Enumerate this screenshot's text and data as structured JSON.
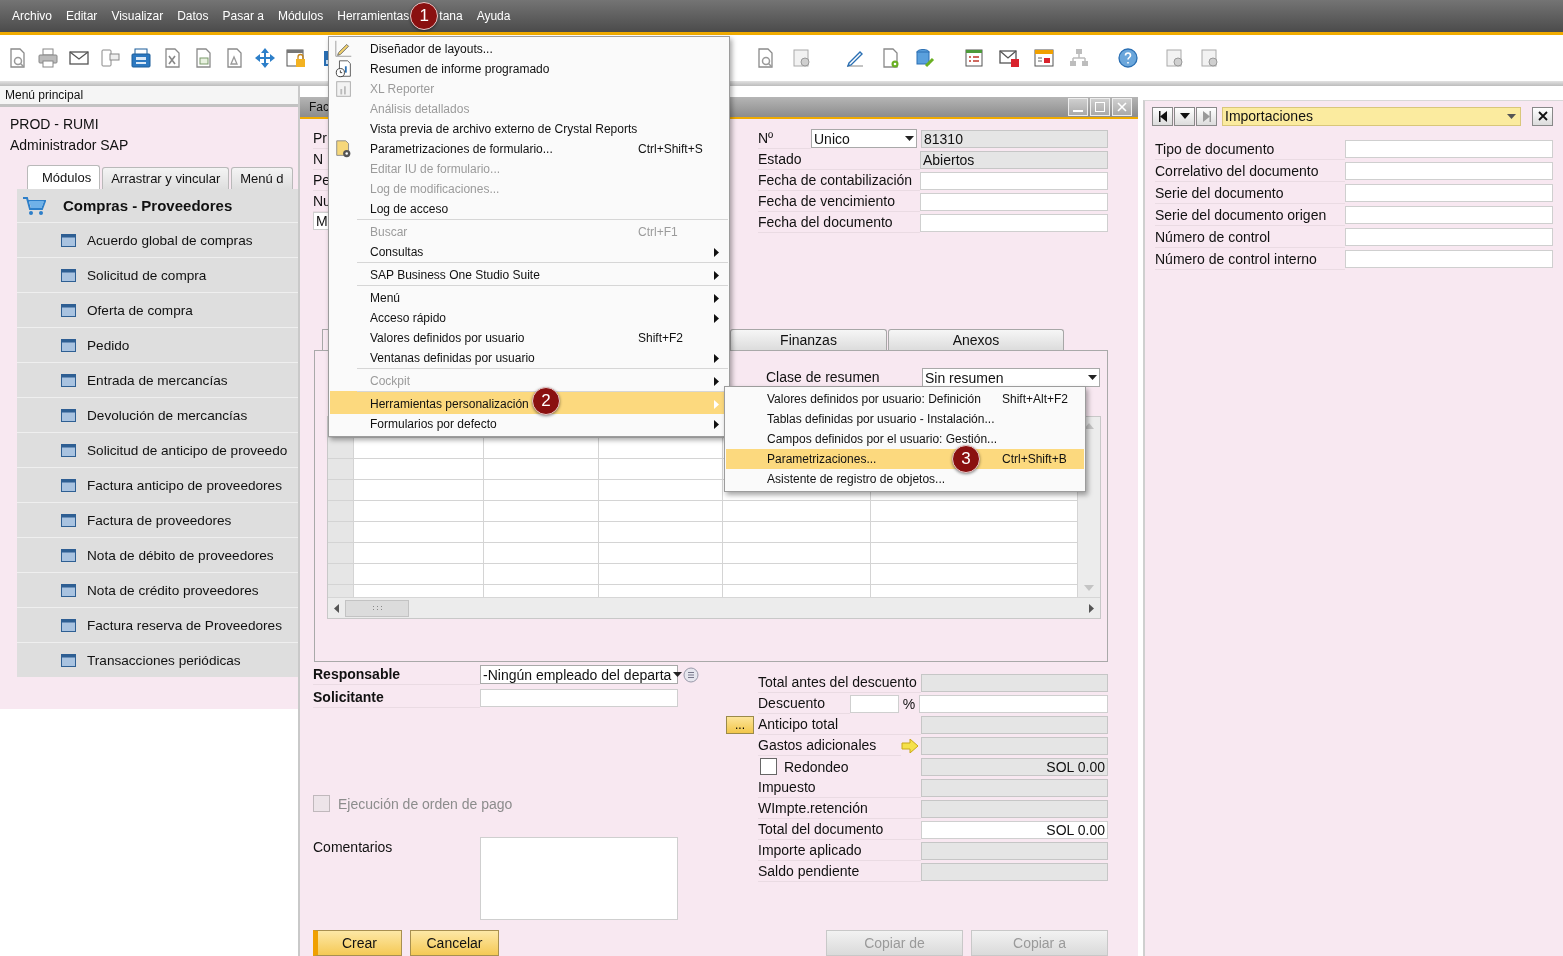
{
  "menu_bar": [
    {
      "label": "Archivo"
    },
    {
      "label": "Editar"
    },
    {
      "label": "Visualizar"
    },
    {
      "label": "Datos"
    },
    {
      "label": "Pasar a"
    },
    {
      "label": "Módulos"
    },
    {
      "label": "Herramientas",
      "callout": "1"
    },
    {
      "label": "tana"
    },
    {
      "label": "Ayuda"
    }
  ],
  "main_menu": {
    "title": "Menú principal",
    "company": "PROD - RUMI",
    "user": "Administrador SAP",
    "tabs": [
      {
        "label": "Módulos",
        "selected": true
      },
      {
        "label": "Arrastrar y vincular",
        "selected": false
      },
      {
        "label": "Menú d",
        "selected": false
      }
    ],
    "module": "Compras - Proveedores",
    "items": [
      "Acuerdo global de compras",
      "Solicitud de compra",
      "Oferta de compra",
      "Pedido",
      "Entrada de mercancías",
      "Devolución de mercancías",
      "Solicitud de anticipo de proveedo",
      "Factura anticipo de proveedores",
      "Factura de proveedores",
      "Nota de débito de proveedores",
      "Nota de crédito proveedores",
      "Factura reserva de Proveedores",
      "Transacciones periódicas"
    ]
  },
  "form_window": {
    "title": "Fac",
    "header_left": [
      "Pr",
      "N",
      "Pe",
      "Nu"
    ],
    "header_left_field": "M",
    "header_right": [
      {
        "label": "Nº",
        "kind": "series",
        "series": "Unico",
        "value": "81310"
      },
      {
        "label": "Estado",
        "kind": "readonly",
        "value": "Abiertos"
      },
      {
        "label": "Fecha de contabilización",
        "kind": "input"
      },
      {
        "label": "Fecha de vencimiento",
        "kind": "input"
      },
      {
        "label": "Fecha del documento",
        "kind": "input"
      }
    ],
    "tabs": [
      {
        "label": "Finanzas",
        "selected": false
      },
      {
        "label": "Anexos",
        "selected": false
      }
    ],
    "summary": {
      "label": "Clase de resumen",
      "value": "Sin resumen"
    },
    "responsible": {
      "label": "Responsable",
      "value": "-Ningún empleado del departa"
    },
    "requester": {
      "label": "Solicitante"
    },
    "payment_order": {
      "label": "Ejecución de orden de pago",
      "checked": false,
      "disabled": true
    },
    "comments": {
      "label": "Comentarios"
    },
    "totals": [
      {
        "label": "Total antes del descuento",
        "kind": "readonly"
      },
      {
        "label": "Descuento",
        "kind": "percent",
        "unit": "%"
      },
      {
        "label": "Anticipo total",
        "kind": "button",
        "button": "..."
      },
      {
        "label": "Gastos adicionales",
        "kind": "arrow"
      },
      {
        "label": "Redondeo",
        "kind": "checkbox",
        "checked": false,
        "value": "SOL 0.00"
      },
      {
        "label": "Impuesto",
        "kind": "readonly"
      },
      {
        "label": "WImpte.retención",
        "kind": "readonly"
      },
      {
        "label": "Total del documento",
        "kind": "input",
        "value": "SOL 0.00"
      },
      {
        "label": "Importe aplicado",
        "kind": "readonly"
      },
      {
        "label": "Saldo pendiente",
        "kind": "readonly"
      }
    ],
    "buttons": [
      {
        "label": "Crear",
        "disabled": false
      },
      {
        "label": "Cancelar",
        "disabled": false
      },
      {
        "label": "Copiar de",
        "disabled": true
      },
      {
        "label": "Copiar a",
        "disabled": true
      }
    ]
  },
  "side_panel": {
    "selector": "Importaciones",
    "fields": [
      "Tipo de documento",
      "Correlativo del documento",
      "Serie del documento",
      "Serie del documento origen",
      "Número de control",
      "Número de control interno"
    ]
  },
  "tools_menu": {
    "items": [
      {
        "label": "Diseñador de layouts...",
        "disabled": false,
        "selected": false,
        "submenu": false,
        "separator_before": false
      },
      {
        "label": "Resumen de informe programado",
        "disabled": false,
        "selected": false,
        "submenu": false,
        "separator_before": false
      },
      {
        "label": "XL Reporter",
        "disabled": true,
        "selected": false,
        "submenu": false,
        "separator_before": false
      },
      {
        "label": "Análisis detallados",
        "disabled": true,
        "selected": false,
        "submenu": false,
        "separator_before": false
      },
      {
        "label": "Vista previa de archivo externo de Crystal Reports",
        "disabled": false,
        "selected": false,
        "submenu": false,
        "separator_before": false
      },
      {
        "label": "Parametrizaciones de formulario...",
        "shortcut": "Ctrl+Shift+S",
        "disabled": false,
        "selected": false,
        "submenu": false,
        "separator_before": false
      },
      {
        "label": "Editar IU de formulario...",
        "disabled": true,
        "selected": false,
        "submenu": false,
        "separator_before": false
      },
      {
        "label": "Log de modificaciones...",
        "disabled": true,
        "selected": false,
        "submenu": false,
        "separator_before": false
      },
      {
        "label": "Log de acceso",
        "disabled": false,
        "selected": false,
        "submenu": false,
        "separator_before": false
      },
      {
        "label": "Buscar",
        "shortcut": "Ctrl+F1",
        "disabled": true,
        "selected": false,
        "submenu": false,
        "separator_before": true
      },
      {
        "label": "Consultas",
        "disabled": false,
        "selected": false,
        "submenu": true,
        "separator_before": false
      },
      {
        "label": "SAP Business One Studio Suite",
        "disabled": false,
        "selected": false,
        "submenu": true,
        "separator_before": true
      },
      {
        "label": "Menú",
        "disabled": false,
        "selected": false,
        "submenu": true,
        "separator_before": true
      },
      {
        "label": "Acceso rápido",
        "disabled": false,
        "selected": false,
        "submenu": true,
        "separator_before": false
      },
      {
        "label": "Valores definidos por usuario",
        "shortcut": "Shift+F2",
        "disabled": false,
        "selected": false,
        "submenu": false,
        "separator_before": false
      },
      {
        "label": "Ventanas definidas por usuario",
        "disabled": false,
        "selected": false,
        "submenu": true,
        "separator_before": false
      },
      {
        "label": "Cockpit",
        "disabled": true,
        "selected": false,
        "submenu": true,
        "separator_before": true
      },
      {
        "label": "Herramientas personalización",
        "disabled": false,
        "selected": true,
        "submenu": true,
        "separator_before": true,
        "callout": "2"
      },
      {
        "label": "Formularios por defecto",
        "disabled": false,
        "selected": false,
        "submenu": true,
        "separator_before": false
      }
    ]
  },
  "customization_submenu": {
    "items": [
      {
        "label": "Valores definidos por usuario: Definición",
        "shortcut": "Shift+Alt+F2",
        "selected": false
      },
      {
        "label": "Tablas definidas por usuario - Instalación...",
        "selected": false
      },
      {
        "label": "Campos definidos por el usuario: Gestión...",
        "selected": false
      },
      {
        "label": "Parametrizaciones...",
        "shortcut": "Ctrl+Shift+B",
        "selected": true,
        "callout": "3"
      },
      {
        "label": "Asistente de registro de objetos...",
        "selected": false
      }
    ]
  }
}
